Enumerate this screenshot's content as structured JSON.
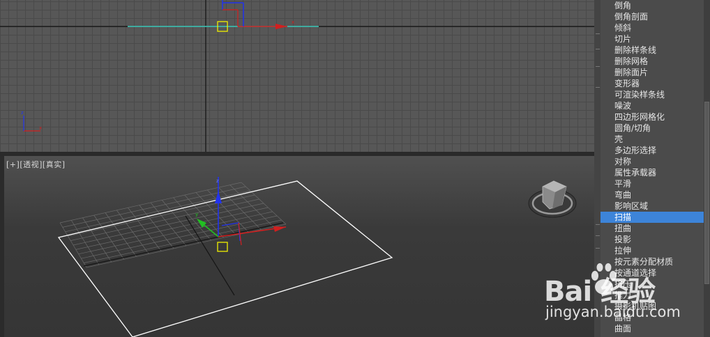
{
  "viewports": {
    "perspective_label": {
      "plus": "[+]",
      "view": "[透视]",
      "shading": "[真实]"
    },
    "axis_labels": {
      "x": "x",
      "y": "y",
      "z": "z"
    }
  },
  "modifier_list": {
    "items": [
      "倒角",
      "倒角剖面",
      "倾斜",
      "切片",
      "删除样条线",
      "删除网格",
      "删除面片",
      "变形器",
      "可渲染样条线",
      "噪波",
      "四边形网格化",
      "圆角/切角",
      "壳",
      "多边形选择",
      "对称",
      "属性承载器",
      "平滑",
      "弯曲",
      "影响区域",
      "扫描",
      "扭曲",
      "投影",
      "拉伸",
      "按元素分配材质",
      "按通道选择",
      "挤压",
      "推力",
      "摄影机贴图",
      "晶格",
      "曲面"
    ],
    "selected": "扫描"
  },
  "watermark": {
    "logo_text": "Bai  经验",
    "url": "jingyan.baidu.com"
  },
  "colors": {
    "selection": "#3d84d9",
    "axis_x": "#d21f1f",
    "axis_y": "#22c022",
    "axis_z": "#2233ee",
    "gizmo_yellow": "#f0f000",
    "spline_cyan": "#40d0c0"
  }
}
